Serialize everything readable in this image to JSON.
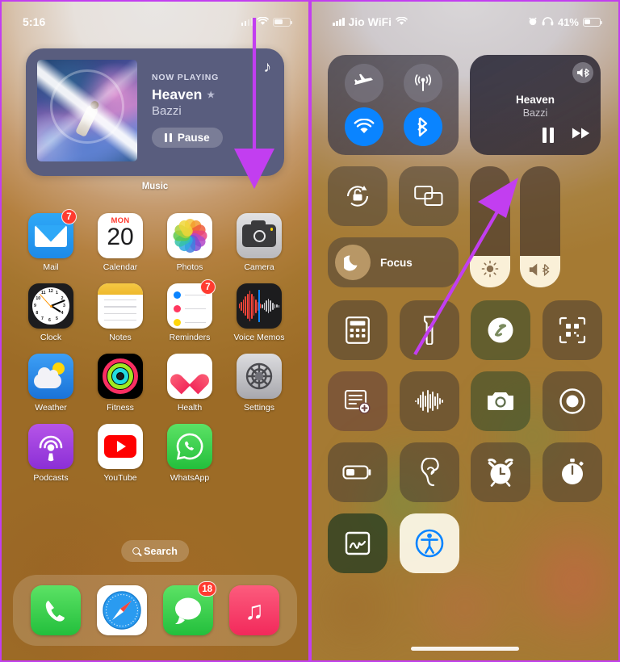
{
  "annotation": {
    "accent_color": "#c23ef0",
    "arrow_left": "swipe-down-arrow",
    "arrow_right": "point-to-music-card-arrow"
  },
  "left_screen": {
    "name": "iphone-home-screen",
    "status_bar": {
      "time": "5:16",
      "signal_icon": "cellular-signal-icon",
      "wifi_icon": "wifi-icon",
      "battery_icon": "battery-icon",
      "battery_fill_pct": 55
    },
    "widget": {
      "app_label": "Music",
      "now_playing_label": "NOW PLAYING",
      "track": "Heaven",
      "star": "★",
      "artist": "Bazzi",
      "pause_label": "Pause",
      "corner_icon": "music-note-icon",
      "album_art": "album-artwork"
    },
    "apps": [
      {
        "label": "Mail",
        "icon": "mail-icon",
        "badge": "7"
      },
      {
        "label": "Calendar",
        "icon": "calendar-icon",
        "badge": "",
        "dow": "MON",
        "day": "20"
      },
      {
        "label": "Photos",
        "icon": "photos-icon",
        "badge": ""
      },
      {
        "label": "Camera",
        "icon": "camera-icon",
        "badge": ""
      },
      {
        "label": "Clock",
        "icon": "clock-icon",
        "badge": ""
      },
      {
        "label": "Notes",
        "icon": "notes-icon",
        "badge": ""
      },
      {
        "label": "Reminders",
        "icon": "reminders-icon",
        "badge": "7"
      },
      {
        "label": "Voice Memos",
        "icon": "voice-memos-icon",
        "badge": ""
      },
      {
        "label": "Weather",
        "icon": "weather-icon",
        "badge": ""
      },
      {
        "label": "Fitness",
        "icon": "fitness-icon",
        "badge": ""
      },
      {
        "label": "Health",
        "icon": "health-icon",
        "badge": ""
      },
      {
        "label": "Settings",
        "icon": "settings-icon",
        "badge": ""
      },
      {
        "label": "Podcasts",
        "icon": "podcasts-icon",
        "badge": ""
      },
      {
        "label": "YouTube",
        "icon": "youtube-icon",
        "badge": ""
      },
      {
        "label": "WhatsApp",
        "icon": "whatsapp-icon",
        "badge": ""
      }
    ],
    "search": {
      "label": "Search",
      "icon": "search-icon"
    },
    "dock": [
      {
        "label": "Phone",
        "icon": "phone-icon",
        "badge": ""
      },
      {
        "label": "Safari",
        "icon": "safari-icon",
        "badge": ""
      },
      {
        "label": "Messages",
        "icon": "messages-icon",
        "badge": "18"
      },
      {
        "label": "Music",
        "icon": "music-icon",
        "badge": ""
      }
    ]
  },
  "right_screen": {
    "name": "iphone-control-center",
    "status_bar": {
      "carrier": "Jio WiFi",
      "signal_icon": "cellular-signal-icon",
      "wifi_icon": "wifi-icon",
      "alarm_icon": "alarm-clock-icon",
      "headphones_icon": "headphones-icon",
      "battery_pct": "41%",
      "battery_icon": "battery-icon",
      "battery_fill_pct": 41
    },
    "connectivity": [
      {
        "name": "airplane-mode-toggle",
        "icon": "airplane-icon",
        "state": "off"
      },
      {
        "name": "cellular-data-toggle",
        "icon": "cellular-icon",
        "state": "off"
      },
      {
        "name": "wifi-toggle",
        "icon": "wifi-icon",
        "state": "on"
      },
      {
        "name": "bluetooth-toggle",
        "icon": "bluetooth-icon",
        "state": "on"
      }
    ],
    "now_playing": {
      "title": "Heaven",
      "artist": "Bazzi",
      "airplay_icon": "airplay-bluetooth-icon",
      "pause_icon": "pause-icon",
      "next_icon": "fast-forward-icon"
    },
    "small_tiles": [
      {
        "name": "rotation-lock-toggle",
        "icon": "rotation-lock-icon"
      },
      {
        "name": "screen-mirroring-tile",
        "icon": "screen-mirroring-icon"
      }
    ],
    "focus": {
      "label": "Focus",
      "icon": "moon-icon"
    },
    "sliders": [
      {
        "name": "brightness-slider",
        "icon": "brightness-icon",
        "value": 26
      },
      {
        "name": "volume-slider",
        "icon": "volume-bluetooth-icon",
        "value": 26
      }
    ],
    "grid": [
      {
        "name": "calculator-button",
        "icon": "calculator-icon",
        "tint": ""
      },
      {
        "name": "flashlight-button",
        "icon": "flashlight-icon",
        "tint": ""
      },
      {
        "name": "shazam-button",
        "icon": "shazam-icon",
        "tint": "tint-green"
      },
      {
        "name": "qr-code-scanner-button",
        "icon": "qr-code-icon",
        "tint": ""
      },
      {
        "name": "new-note-button",
        "icon": "new-note-icon",
        "tint": "tint-red"
      },
      {
        "name": "voice-memo-button",
        "icon": "voice-memo-icon",
        "tint": ""
      },
      {
        "name": "camera-button",
        "icon": "camera-icon",
        "tint": "tint-green"
      },
      {
        "name": "screen-record-button",
        "icon": "screen-record-icon",
        "tint": ""
      },
      {
        "name": "low-power-mode-button",
        "icon": "low-battery-icon",
        "tint": ""
      },
      {
        "name": "hearing-button",
        "icon": "ear-icon",
        "tint": ""
      },
      {
        "name": "alarm-button",
        "icon": "alarm-clock-icon",
        "tint": ""
      },
      {
        "name": "stopwatch-button",
        "icon": "stopwatch-icon",
        "tint": ""
      },
      {
        "name": "quick-note-button",
        "icon": "quick-note-icon",
        "tint": "tint-dkgreen"
      },
      {
        "name": "accessibility-button",
        "icon": "accessibility-icon",
        "tint": "active"
      }
    ],
    "home_indicator": "home-indicator-bar"
  }
}
